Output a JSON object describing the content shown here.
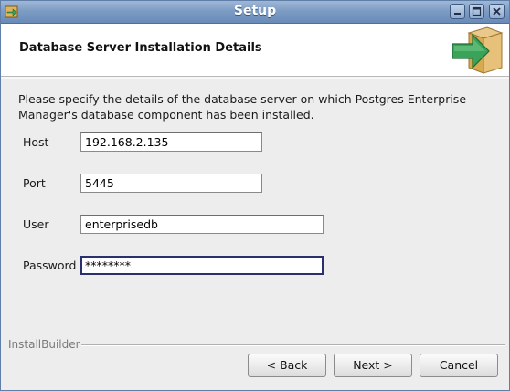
{
  "window": {
    "title": "Setup"
  },
  "header": {
    "title": "Database Server Installation Details"
  },
  "description": "Please specify the details of the database server on which Postgres Enterprise Manager's database component has been installed.",
  "form": {
    "host": {
      "label": "Host",
      "value": "192.168.2.135"
    },
    "port": {
      "label": "Port",
      "value": "5445"
    },
    "user": {
      "label": "User",
      "value": "enterprisedb"
    },
    "password": {
      "label": "Password",
      "value": "********"
    }
  },
  "footer": {
    "brand": "InstallBuilder",
    "back_label": "< Back",
    "next_label": "Next >",
    "cancel_label": "Cancel"
  },
  "colors": {
    "titlebar": "#7d9cc4",
    "focus_border": "#2a2f6e",
    "logo_box": "#d9b36a",
    "logo_arrow": "#3aa35a"
  }
}
